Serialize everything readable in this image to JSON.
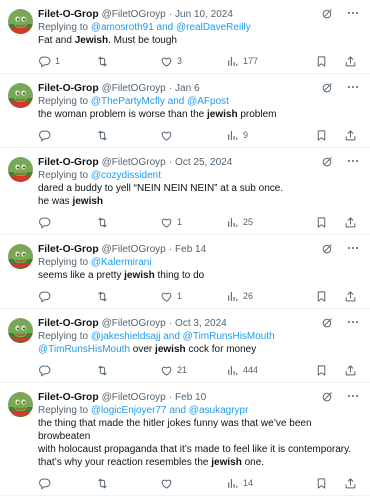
{
  "tweets": [
    {
      "name": "Filet-O-Grop",
      "handle": "@FiletOGroyp",
      "date": "Jun 10, 2024",
      "reply_prefix": "Replying to ",
      "reply_to": "@amosroth91 and @realDaveReilly",
      "lines": [
        {
          "pre": "Fat and ",
          "bold": "Jewish",
          "post": ". Must be tough"
        }
      ],
      "replies": "1",
      "retweets": "",
      "likes": "3",
      "views": "177"
    },
    {
      "name": "Filet-O-Grop",
      "handle": "@FiletOGroyp",
      "date": "Jan 6",
      "reply_prefix": "Replying to ",
      "reply_to": "@ThePartyMcfly and @AFpost",
      "lines": [
        {
          "pre": "the woman problem is worse than the ",
          "bold": "jewish",
          "post": " problem"
        }
      ],
      "replies": "",
      "retweets": "",
      "likes": "",
      "views": "9"
    },
    {
      "name": "Filet-O-Grop",
      "handle": "@FiletOGroyp",
      "date": "Oct 25, 2024",
      "reply_prefix": "Replying to ",
      "reply_to": "@cozydissident",
      "lines": [
        {
          "pre": "dared a buddy to yell “NEIN NEIN NEIN” at a sub once.",
          "bold": "",
          "post": ""
        },
        {
          "pre": "he was ",
          "bold": "jewish",
          "post": ""
        }
      ],
      "replies": "",
      "retweets": "",
      "likes": "1",
      "views": "25"
    },
    {
      "name": "Filet-O-Grop",
      "handle": "@FiletOGroyp",
      "date": "Feb 14",
      "reply_prefix": "Replying to ",
      "reply_to": "@Kalermirani",
      "lines": [
        {
          "pre": "seems like a pretty ",
          "bold": "jewish",
          "post": " thing to do"
        }
      ],
      "replies": "",
      "retweets": "",
      "likes": "1",
      "views": "26"
    },
    {
      "name": "Filet-O-Grop",
      "handle": "@FiletOGroyp",
      "date": "Oct 3, 2024",
      "reply_prefix": "Replying to ",
      "reply_to": "@jakeshieldsajj and @TimRunsHisMouth",
      "lines": [
        {
          "mention": "@TimRunsHisMouth",
          "pre": " over ",
          "bold": "jewish",
          "post": " cock for money"
        }
      ],
      "replies": "",
      "retweets": "",
      "likes": "21",
      "views": "444"
    },
    {
      "name": "Filet-O-Grop",
      "handle": "@FiletOGroyp",
      "date": "Feb 10",
      "reply_prefix": "Replying to ",
      "reply_to": "@logicEnjoyer77 and @asukagrypr",
      "lines": [
        {
          "pre": "the thing that made the hitler jokes funny was that we’ve been browbeaten",
          "bold": "",
          "post": ""
        },
        {
          "pre": "with holocaust propaganda that it’s made to feel like it is contemporary.",
          "bold": "",
          "post": ""
        },
        {
          "pre": "that’s why your reaction resembles the ",
          "bold": "jewish",
          "post": " one."
        }
      ],
      "replies": "",
      "retweets": "",
      "likes": "",
      "views": "14"
    }
  ],
  "icons": {
    "grok": "grok-icon",
    "more": "more-icon",
    "reply": "reply-icon",
    "retweet": "retweet-icon",
    "like": "like-icon",
    "views": "views-icon",
    "bookmark": "bookmark-icon",
    "share": "share-icon"
  },
  "colors": {
    "link": "#1d9bf0",
    "muted": "#536471",
    "text": "#0f1419"
  }
}
